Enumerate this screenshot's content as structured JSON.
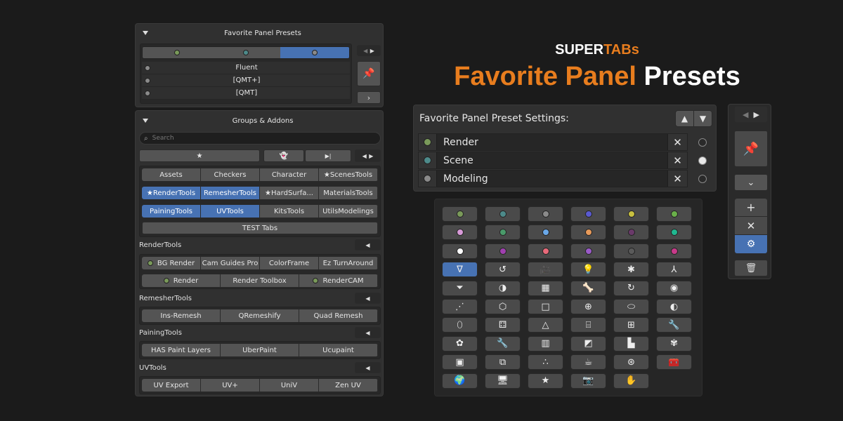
{
  "brand": {
    "title_part1": "SUPER",
    "title_part2": "TABs",
    "heading_part1": "Favorite Panel",
    "heading_part2": "Presets",
    "accent": "#e87d1e"
  },
  "left_panel": {
    "favorites_header": "Favorite Panel Presets",
    "preset_tab_colors": [
      "#7a9a5a",
      "#4d8a8a",
      "#8a8a8a"
    ],
    "preset_items": [
      {
        "label": "Fluent",
        "color": "#8a8a8a"
      },
      {
        "label": "[QMT+]",
        "color": "#8a8a8a"
      },
      {
        "label": "[QMT]",
        "color": "#8a8a8a"
      }
    ],
    "groups_header": "Groups & Addons",
    "search_placeholder": "Search",
    "group_rows": [
      [
        {
          "label": "Assets"
        },
        {
          "label": "Checkers"
        },
        {
          "label": "Character"
        },
        {
          "label": "ScenesTools",
          "star": true
        }
      ],
      [
        {
          "label": "RenderTools",
          "star": true,
          "active": true
        },
        {
          "label": "RemesherTools",
          "active": true
        },
        {
          "label": "HardSurfa...",
          "star": true
        },
        {
          "label": "MaterialsTools"
        }
      ],
      [
        {
          "label": "PainingTools",
          "active": true
        },
        {
          "label": "UVTools",
          "active": true
        },
        {
          "label": "KitsTools"
        },
        {
          "label": "UtilsModelings"
        }
      ]
    ],
    "test_tabs": "TEST Tabs",
    "render_tools": {
      "label": "RenderTools",
      "row1": [
        {
          "label": "BG Render",
          "dot": "#7a9a5a"
        },
        {
          "label": "Cam Guides Pro"
        },
        {
          "label": "ColorFrame"
        },
        {
          "label": "Ez TurnAround"
        }
      ],
      "row2": [
        {
          "label": "Render",
          "dot": "#7a9a5a"
        },
        {
          "label": "Render Toolbox"
        },
        {
          "label": "RenderCAM",
          "dot": "#7a9a5a"
        }
      ]
    },
    "remesher_tools": {
      "label": "RemesherTools",
      "items": [
        "Ins-Remesh",
        "QRemeshify",
        "Quad Remesh"
      ]
    },
    "paining_tools": {
      "label": "PainingTools",
      "items": [
        "HAS Paint Layers",
        "UberPaint",
        "Ucupaint"
      ]
    },
    "uv_tools": {
      "label": "UVTools",
      "items": [
        "UV Export",
        "UV+",
        "UniV",
        "Zen UV"
      ]
    }
  },
  "settings": {
    "title": "Favorite Panel Preset Settings:",
    "items": [
      {
        "label": "Render",
        "color": "#7a9a5a",
        "selected": false
      },
      {
        "label": "Scene",
        "color": "#4d8a8a",
        "selected": true
      },
      {
        "label": "Modeling",
        "color": "#8a8a8a",
        "selected": false
      }
    ]
  },
  "color_grid": [
    [
      "#7a9a5a",
      "#4d8a8a",
      "#8a8a8a",
      "#5a5ad0",
      "#c8c040",
      "#6ab04a"
    ],
    [
      "#d89ad8",
      "#4a9a6a",
      "#6aa8e8",
      "#e89a5a",
      "#6a3a6a",
      "#20b890"
    ],
    [
      "#ffffff",
      "#a040b0",
      "#e86a7a",
      "#9a5ac8",
      "#5a5a5a",
      "#c83a8a"
    ]
  ],
  "icon_grid": [
    [
      "funnel-v-icon",
      "curve-icon",
      "camera-film-icon",
      "bulb-icon",
      "figure-icon",
      "bone-armature-icon"
    ],
    [
      "funnel-icon",
      "shading-icon",
      "checker-icon",
      "bone-icon",
      "circle-arrow-icon",
      "orbit-icon"
    ],
    [
      "vertices-icon",
      "cube-wire-icon",
      "square-icon",
      "globe-icon",
      "ellipse-icon",
      "half-circle-icon"
    ],
    [
      "capsule-icon",
      "dice-icon",
      "cone-icon",
      "cylinder-icon",
      "grid-icon",
      "wrench-icon"
    ],
    [
      "brain-icon",
      "wrench-solid-icon",
      "bars-icon",
      "diag-square-icon",
      "step-square-icon",
      "butterfly-icon"
    ],
    [
      "frame-icon",
      "box-icon",
      "bubbles-icon",
      "mug-icon",
      "film-reel-icon",
      "toolbox-icon"
    ],
    [
      "earth-icon",
      "monitor-icon",
      "star-icon",
      "photo-camera-icon",
      "hand-icon"
    ]
  ]
}
